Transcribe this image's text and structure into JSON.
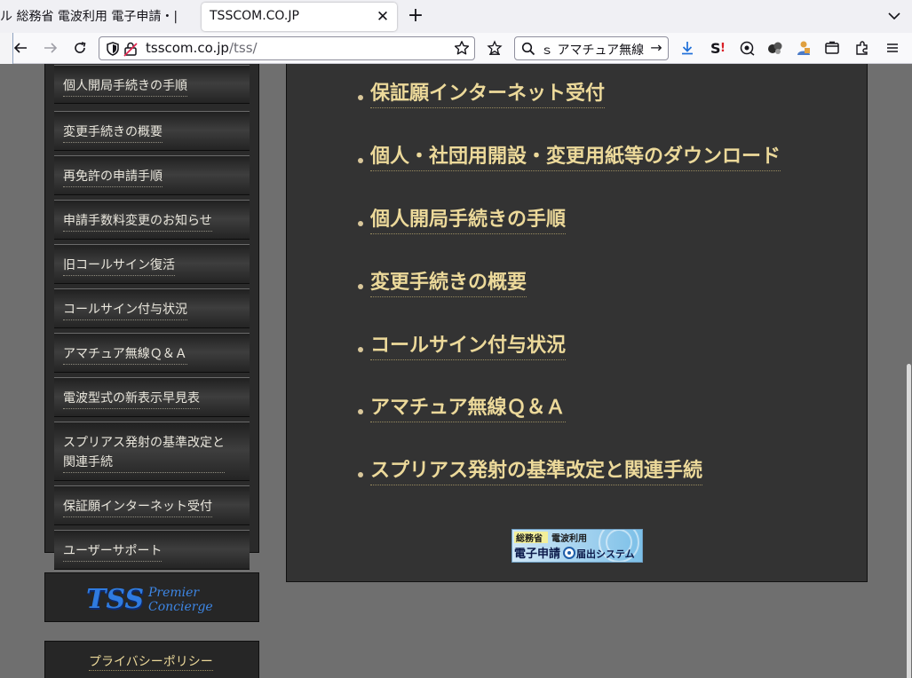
{
  "browser": {
    "prev_tab_title": "ル 総務省 電波利用 電子申請・|",
    "active_tab_title": "TSSCOM.CO.JP",
    "url_host": "tsscom.co.jp",
    "url_path": "/tss/",
    "search_text": "ｓ アマチュア無線"
  },
  "sidebar": {
    "items": [
      {
        "label": "個人開局手続きの手順"
      },
      {
        "label": "変更手続きの概要"
      },
      {
        "label": "再免許の申請手順"
      },
      {
        "label": "申請手数料変更のお知らせ"
      },
      {
        "label": "旧コールサイン復活"
      },
      {
        "label": "コールサイン付与状況"
      },
      {
        "label": "アマチュア無線Ｑ＆Ａ"
      },
      {
        "label": "電波型式の新表示早見表"
      },
      {
        "label_line1": "スプリアス発射の基準改定と",
        "label_line2": "関連手続"
      },
      {
        "label": "保証願インターネット受付"
      },
      {
        "label": "ユーザーサポート"
      }
    ]
  },
  "tss_logo": {
    "brand": "TSS",
    "line1": "Premier",
    "line2": "Concierge"
  },
  "policy_link": "プライバシーポリシー",
  "main_links": [
    "保証願インターネット受付",
    "個人・社団用開設・変更用紙等のダウンロード",
    "個人開局手続きの手順",
    "変更手続きの概要",
    "コールサイン付与状況",
    "アマチュア無線Ｑ＆Ａ",
    "スプリアス発射の基準改定と関連手続"
  ],
  "banner": {
    "line1a": "総務省",
    "line1b": "電波利用",
    "line2a": "電子申請",
    "line2b": "届出システム"
  }
}
